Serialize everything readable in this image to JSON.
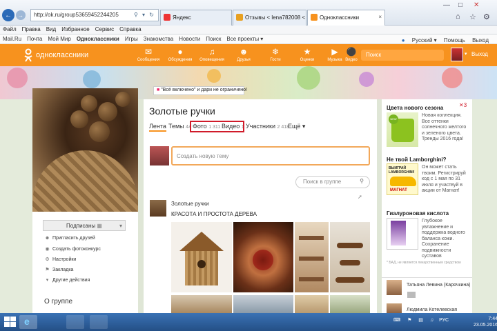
{
  "browser": {
    "url": "http://ok.ru/group53659452244205",
    "tabs": [
      {
        "label": "Яндекс",
        "active": false
      },
      {
        "label": "Отзывы < lena782008 < Польз...",
        "active": false
      },
      {
        "label": "Одноклассники",
        "active": true
      }
    ],
    "menu": [
      "Файл",
      "Правка",
      "Вид",
      "Избранное",
      "Сервис",
      "Справка"
    ],
    "favorites": [
      "Mail.Ru",
      "Почта",
      "Мой Мир",
      "Одноклассники",
      "Игры",
      "Знакомства",
      "Новости",
      "Поиск",
      "Все проекты ▾"
    ],
    "language": "Русский ▾",
    "help": "Помощь",
    "exit": "Выход"
  },
  "ok_header": {
    "logo_text": "одноклассники",
    "nav": [
      {
        "label": "Сообщения",
        "icon": "envelope-icon"
      },
      {
        "label": "Обсуждения",
        "icon": "chat-icon"
      },
      {
        "label": "Оповещения",
        "icon": "bell-icon"
      },
      {
        "label": "Друзья",
        "icon": "friends-icon"
      },
      {
        "label": "Гости",
        "icon": "footprints-icon"
      },
      {
        "label": "Оценки",
        "icon": "star-icon"
      },
      {
        "label": "Музыка",
        "icon": "music-icon"
      },
      {
        "label": "Видео",
        "icon": "video-icon"
      }
    ],
    "search_placeholder": "Поиск",
    "exit": "Выход",
    "accent": "#f7921e"
  },
  "promo": {
    "icon": "gift-icon",
    "text": "\"Всё включено\" и дари не ограничено!"
  },
  "left": {
    "subscribed": "Подписаны",
    "menu": [
      {
        "label": "Пригласить друзей",
        "icon": "invite-icon"
      },
      {
        "label": "Создать фотоконкурс",
        "icon": "contest-icon"
      },
      {
        "label": "Настройки",
        "icon": "settings-icon"
      },
      {
        "label": "Закладка",
        "icon": "bookmark-icon"
      },
      {
        "label": "Другие действия",
        "icon": "chevron-down-icon"
      }
    ],
    "about": "О группе"
  },
  "group": {
    "title": "Золотые ручки",
    "tabs": [
      {
        "label": "Лента",
        "count": ""
      },
      {
        "label": "Темы",
        "count": "44"
      },
      {
        "label": "Фото",
        "count": "1 311"
      },
      {
        "label": "Видео",
        "count": "1"
      },
      {
        "label": "Участники",
        "count": "2 418"
      },
      {
        "label": "Ещё ▾",
        "count": ""
      }
    ],
    "new_topic_placeholder": "Создать новую тему",
    "search_placeholder": "Поиск в группе",
    "post": {
      "group": "Золотые ручки",
      "title": "КРАСОТА И ПРОСТОТА ДЕРЕВА"
    }
  },
  "right": {
    "ads": [
      {
        "title": "Цвета нового сезона",
        "text": "Новая коллекция. Все оттенки солнечного желтого и зеленого цвета. Тренды 2016 года!",
        "badge": "NEW"
      },
      {
        "title": "Не твой Lamborghini?",
        "text": "Он может стать твоим. Регистрируй код с 1 мая по 31 июля и участвуй в акции от Магнат!",
        "img_line1": "ВЫИГРАЙ",
        "img_line2": "LAMBORGHINI!",
        "img_brand": "МАГНАТ"
      },
      {
        "title": "Гиалуроновая кислота",
        "text": "Глубокое увлажнение и поддержка водного баланса кожи. Сохранение подвижности суставов"
      }
    ],
    "disclaimer": "* БАД, не является лекарственным средством",
    "friends": [
      "Татьяна Левина (Карячкина)",
      "Людмила Котелевская"
    ]
  },
  "taskbar": {
    "tray_lang": "РУС",
    "time": "7:44",
    "date": "23.05.2016"
  }
}
